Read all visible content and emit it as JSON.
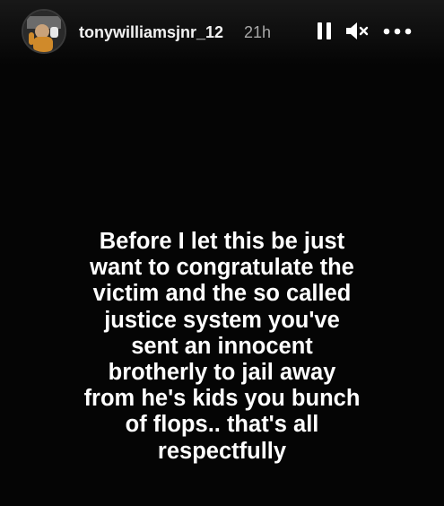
{
  "story": {
    "username": "tonywilliamsjnr_12",
    "timestamp": "21h",
    "controls": {
      "pause_icon": "pause-icon",
      "mute_icon": "speaker-muted-icon",
      "more_icon": "more-horizontal-icon"
    },
    "message_lines": [
      "Before I let this be just",
      "want to congratulate the",
      "victim and the so called",
      "justice system you've",
      "sent an innocent",
      "brotherly to  jail away",
      "from he's kids you bunch",
      "of flops.. that's all",
      "respectfully"
    ]
  },
  "colors": {
    "background": "#050505",
    "text": "#ffffff",
    "timestamp": "#a8a8a8"
  }
}
